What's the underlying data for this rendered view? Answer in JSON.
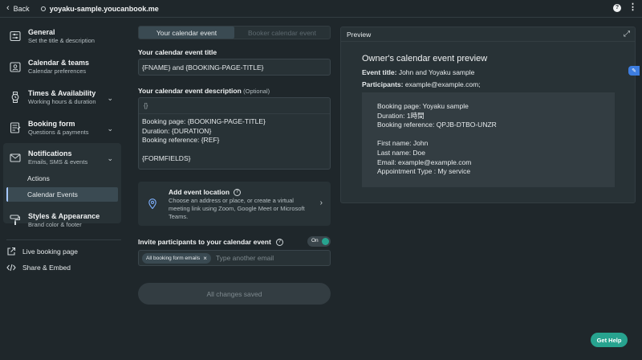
{
  "topbar": {
    "back_label": "Back",
    "url": "yoyaku-sample.youcanbook.me"
  },
  "sidebar": {
    "items": [
      {
        "title": "General",
        "subtitle": "Set the title & description",
        "icon": "sliders-icon"
      },
      {
        "title": "Calendar & teams",
        "subtitle": "Calendar preferences",
        "icon": "calendar-user-icon"
      },
      {
        "title": "Times & Availability",
        "subtitle": "Working hours & duration",
        "icon": "watch-icon"
      },
      {
        "title": "Booking form",
        "subtitle": "Questions & payments",
        "icon": "form-icon"
      },
      {
        "title": "Notifications",
        "subtitle": "Emails, SMS & events",
        "icon": "envelope-icon"
      },
      {
        "title": "Styles & Appearance",
        "subtitle": "Brand color & footer",
        "icon": "paint-roller-icon"
      }
    ],
    "sub_items": [
      "Actions",
      "Calendar Events"
    ],
    "links": [
      {
        "label": "Live booking page",
        "icon": "external-link-icon"
      },
      {
        "label": "Share & Embed",
        "icon": "code-icon"
      }
    ]
  },
  "main": {
    "tabs": [
      "Your calendar event",
      "Booker calendar event"
    ],
    "title_label": "Your calendar event title",
    "title_value": "{FNAME} and {BOOKING-PAGE-TITLE}",
    "desc_label": "Your calendar event description",
    "desc_optional": "(Optional)",
    "desc_toolbar": "{}",
    "desc_value": "Booking page: {BOOKING-PAGE-TITLE}\nDuration: {DURATION}\nBooking reference: {REF}\n\n{FORMFIELDS}",
    "location": {
      "title": "Add event location",
      "body": "Choose an address or place, or create a virtual meeting link using Zoom, Google Meet or Microsoft Teams."
    },
    "invite_label": "Invite participants to your calendar event",
    "toggle_label": "On",
    "chip_label": "All booking form emails",
    "email_placeholder": "Type another email",
    "save_label": "All changes saved"
  },
  "preview": {
    "header": "Preview",
    "title": "Owner's calendar event preview",
    "event_title_label": "Event title:",
    "event_title_value": "John and Yoyaku sample",
    "participants_label": "Participants:",
    "participants_value": "example@example.com;",
    "body": "Booking page: Yoyaku sample\nDuration: 1時間\nBooking reference: QPJB-DTBO-UNZR\n\nFirst name: John\nLast name: Doe\nEmail: example@example.com\nAppointment Type : My service"
  },
  "help_button": "Get Help",
  "colors": {
    "background": "#1f272b",
    "panel": "#283236",
    "accent_green": "#27a38f",
    "active_indicator": "#a6c8ff"
  }
}
